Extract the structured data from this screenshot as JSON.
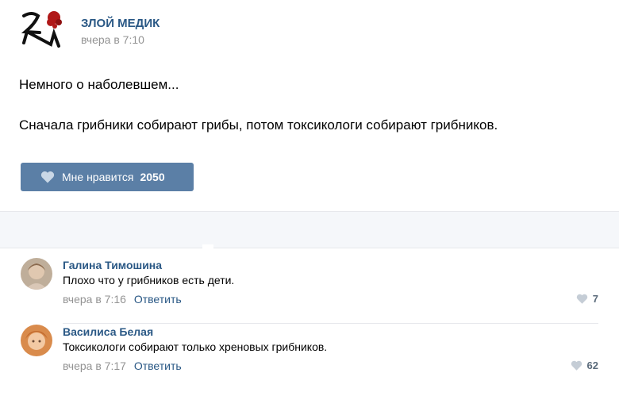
{
  "post": {
    "author": "ЗЛОЙ МЕДИК",
    "time": "вчера в 7:10",
    "paragraphs": [
      "Немного о наболевшем...",
      "Сначала грибники собирают грибы, потом токсикологи собирают грибников."
    ],
    "like_label": "Мне нравится",
    "like_count": "2050",
    "logo_icon": "zm-monogram-logo",
    "accent_color": "#2a5885",
    "button_color": "#5b7fa6"
  },
  "comments": [
    {
      "author": "Галина Тимошина",
      "text": "Плохо что у грибников есть дети.",
      "time": "вчера в 7:16",
      "reply_label": "Ответить",
      "likes": "7"
    },
    {
      "author": "Василиса Белая",
      "text": "Токсикологи собирают только хреновых грибников.",
      "time": "вчера в 7:17",
      "reply_label": "Ответить",
      "likes": "62"
    }
  ]
}
